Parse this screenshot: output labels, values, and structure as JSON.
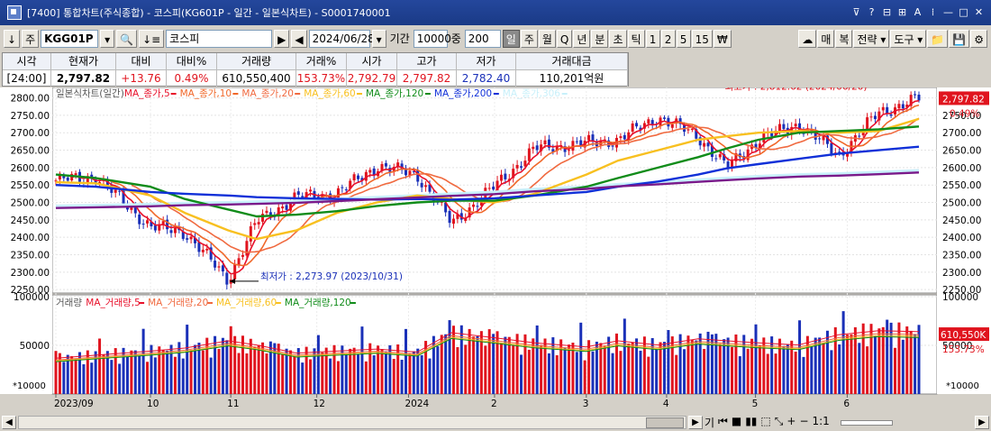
{
  "window": {
    "title": "[7400]  통합차트(주식종합) - 코스피(KG601P - 일간 - 일본식차트) - S0001740001",
    "buttons": [
      {
        "name": "pin-icon",
        "glyph": "⊽"
      },
      {
        "name": "help-icon",
        "glyph": "?"
      },
      {
        "name": "layout-icon",
        "glyph": "⊟"
      },
      {
        "name": "grid-icon",
        "glyph": "⊞"
      },
      {
        "name": "font-size-icon",
        "glyph": "A"
      },
      {
        "name": "settings-icon",
        "glyph": "⁞"
      },
      {
        "name": "minimize-icon",
        "glyph": "—"
      },
      {
        "name": "maximize-icon",
        "glyph": "□"
      },
      {
        "name": "close-icon",
        "glyph": "✕"
      }
    ]
  },
  "toolbar": {
    "down_arrow": "↓",
    "market": "주",
    "code": "KGG01P",
    "search_glyph": "🔍",
    "list_glyph": "↓≡",
    "name": "코스피",
    "next": "▶",
    "prev": "◀",
    "date": "2024/06/28",
    "period_label": "기간",
    "period_value": "10000",
    "interval_label": "중",
    "interval_value": "200",
    "units": [
      "일",
      "주",
      "월",
      "Q",
      "년",
      "분",
      "초",
      "틱",
      "1",
      "2",
      "5",
      "15",
      "₩"
    ],
    "selected_unit": "일",
    "right": [
      "☁",
      "매",
      "복",
      "전략 ▾",
      "도구 ▾",
      "📁",
      "💾",
      "⚙"
    ]
  },
  "quote": {
    "headers": [
      "시각",
      "현재가",
      "대비",
      "대비%",
      "거래량",
      "거래%",
      "시가",
      "고가",
      "저가",
      "거래대금"
    ],
    "values": [
      "[24:00]",
      "2,797.82",
      "+13.76",
      "0.49%",
      "610,550,400",
      "153.73%",
      "2,792.79",
      "2,797.82",
      "2,782.40",
      "110,201억원"
    ]
  },
  "colors": {
    "up": "#e0141e",
    "down": "#1a30b8",
    "ma5": "#e8102a",
    "ma10": "#f0682a",
    "ma20": "#f06a40",
    "ma60": "#f8c020",
    "ma120": "#118c1a",
    "ma200": "#1030d8",
    "ma306": "#7a1a8a",
    "lightline": "#c8f0fa"
  },
  "price_chart": {
    "legend": [
      {
        "text": "일본식차트(일간)",
        "color": "#555"
      },
      {
        "text": "MA_종가,5",
        "color": "#e8102a"
      },
      {
        "text": "MA_종가,10",
        "color": "#f0682a"
      },
      {
        "text": "MA_종가,20",
        "color": "#f06a40"
      },
      {
        "text": "MA_종가,60",
        "color": "#f8c020"
      },
      {
        "text": "MA_종가,120",
        "color": "#118c1a"
      },
      {
        "text": "MA_종가,200",
        "color": "#1030d8"
      },
      {
        "text": "MA_종가,306",
        "color": "#c8f0fa"
      }
    ],
    "y_ticks": [
      2800,
      2750,
      2700,
      2650,
      2600,
      2550,
      2500,
      2450,
      2400,
      2350,
      2300,
      2250
    ],
    "y_labels": [
      "2800.00",
      "2750.00",
      "2700.00",
      "2650.00",
      "2600.00",
      "2550.00",
      "2500.00",
      "2450.00",
      "2400.00",
      "2350.00",
      "2300.00",
      "2250.00"
    ],
    "ylim": [
      2240,
      2830
    ],
    "current_label": "2,797.82",
    "current_value": 2797.82,
    "current_pct": "0.49%",
    "high_annotation": "최고가 : 2,812.62 (2024/06/20)",
    "high_value": 2812.62,
    "low_annotation": "최저가 : 2,273.97 (2023/10/31)",
    "low_value": 2273.97
  },
  "volume_chart": {
    "legend": [
      {
        "text": "거래량",
        "color": "#555"
      },
      {
        "text": "MA_거래량,5",
        "color": "#e8102a"
      },
      {
        "text": "MA_거래량,20",
        "color": "#f06a40"
      },
      {
        "text": "MA_거래량,60",
        "color": "#f8c020"
      },
      {
        "text": "MA_거래량,120",
        "color": "#118c1a"
      }
    ],
    "y_labels": [
      "100000",
      "50000"
    ],
    "unit_label": "*10000",
    "ylim": [
      0,
      100000
    ],
    "current_label": "610,550K",
    "current_value": 61055,
    "current_pct": "153.73%"
  },
  "x_labels": [
    "2023/09",
    "10",
    "11",
    "12",
    "2024",
    "2",
    "3",
    "4",
    "5",
    "6"
  ],
  "chart_data": {
    "type": "candlestick",
    "x": [
      "2023-09-01",
      "2023-09-15",
      "2023-10-04",
      "2023-10-16",
      "2023-10-31",
      "2023-11-10",
      "2023-11-24",
      "2023-12-08",
      "2023-12-22",
      "2024-01-05",
      "2024-01-17",
      "2024-02-01",
      "2024-02-15",
      "2024-03-04",
      "2024-03-15",
      "2024-03-29",
      "2024-04-12",
      "2024-04-22",
      "2024-05-03",
      "2024-05-17",
      "2024-05-31",
      "2024-06-14",
      "2024-06-28"
    ],
    "close": [
      2563,
      2574,
      2430,
      2415,
      2278,
      2445,
      2515,
      2525,
      2605,
      2580,
      2440,
      2545,
      2655,
      2670,
      2680,
      2745,
      2690,
      2600,
      2680,
      2725,
      2635,
      2758,
      2797.82
    ],
    "ma60": [
      2558,
      2555,
      2520,
      2470,
      2420,
      2395,
      2420,
      2470,
      2500,
      2520,
      2510,
      2500,
      2525,
      2580,
      2620,
      2650,
      2680,
      2690,
      2700,
      2705,
      2700,
      2705,
      2740
    ],
    "ma120": [
      2580,
      2570,
      2545,
      2510,
      2480,
      2460,
      2465,
      2475,
      2490,
      2500,
      2505,
      2505,
      2520,
      2545,
      2570,
      2600,
      2630,
      2655,
      2680,
      2700,
      2705,
      2710,
      2718
    ],
    "ma200": [
      2550,
      2545,
      2530,
      2525,
      2520,
      2515,
      2512,
      2510,
      2508,
      2510,
      2508,
      2512,
      2520,
      2530,
      2545,
      2560,
      2580,
      2598,
      2610,
      2625,
      2640,
      2650,
      2660
    ],
    "ma306": [
      2490,
      2492,
      2495,
      2498,
      2500,
      2502,
      2505,
      2510,
      2515,
      2520,
      2525,
      2530,
      2538,
      2545,
      2552,
      2558,
      2565,
      2570,
      2575,
      2580,
      2583,
      2587,
      2592
    ],
    "volume": [
      35000,
      38000,
      42000,
      45000,
      52000,
      48000,
      40000,
      42000,
      44000,
      41000,
      60000,
      55000,
      50000,
      46000,
      52000,
      48000,
      54000,
      52000,
      50000,
      48000,
      58000,
      62000,
      61055
    ]
  },
  "status": {
    "items": [
      "기",
      "⏮",
      "■",
      "▮▮",
      "⬚",
      "⤡",
      "+",
      "−",
      "1:1"
    ]
  }
}
